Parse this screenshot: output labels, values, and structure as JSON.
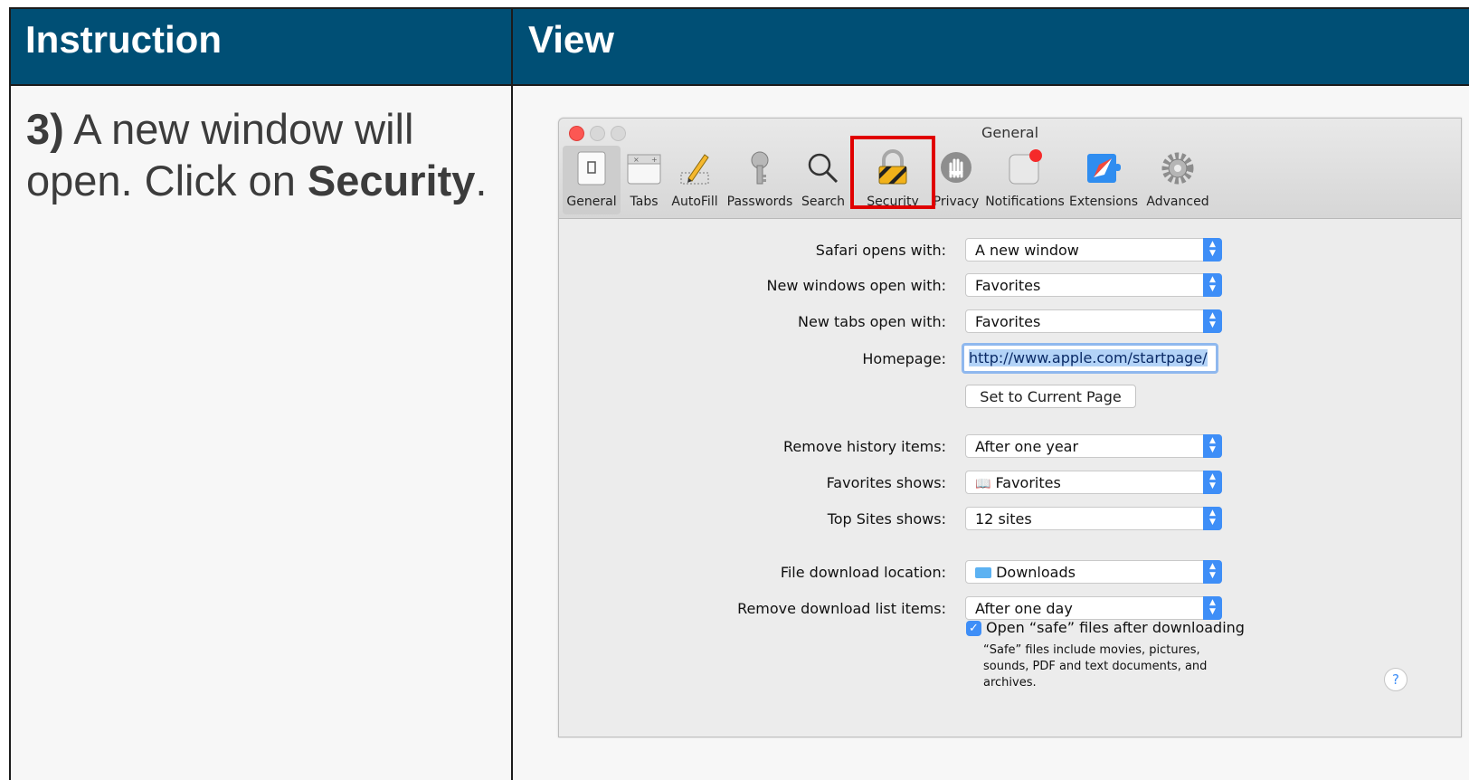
{
  "table": {
    "header_instruction": "Instruction",
    "header_view": "View",
    "step_number": "3)",
    "step_text_1": "A new window will open. Click on",
    "step_target": "Security",
    "step_end": "."
  },
  "window": {
    "title": "General",
    "toolbar": [
      {
        "label": "General",
        "icon": "general-icon"
      },
      {
        "label": "Tabs",
        "icon": "tabs-icon"
      },
      {
        "label": "AutoFill",
        "icon": "autofill-icon"
      },
      {
        "label": "Passwords",
        "icon": "passwords-icon"
      },
      {
        "label": "Search",
        "icon": "search-icon"
      },
      {
        "label": "Security",
        "icon": "lock-icon"
      },
      {
        "label": "Privacy",
        "icon": "privacy-hand-icon"
      },
      {
        "label": "Notifications",
        "icon": "notifications-icon"
      },
      {
        "label": "Extensions",
        "icon": "extensions-icon"
      },
      {
        "label": "Advanced",
        "icon": "gear-icon"
      }
    ],
    "settings": {
      "safari_opens_label": "Safari opens with:",
      "safari_opens_value": "A new window",
      "new_windows_label": "New windows open with:",
      "new_windows_value": "Favorites",
      "new_tabs_label": "New tabs open with:",
      "new_tabs_value": "Favorites",
      "homepage_label": "Homepage:",
      "homepage_value": "http://www.apple.com/startpage/",
      "set_current_label": "Set to Current Page",
      "remove_history_label": "Remove history items:",
      "remove_history_value": "After one year",
      "favorites_shows_label": "Favorites shows:",
      "favorites_shows_value": "Favorites",
      "top_sites_label": "Top Sites shows:",
      "top_sites_value": "12 sites",
      "download_location_label": "File download location:",
      "download_location_value": "Downloads",
      "remove_download_label": "Remove download list items:",
      "remove_download_value": "After one day",
      "open_safe_label": "Open “safe” files after downloading",
      "open_safe_checked": true,
      "safe_note": "“Safe” files include movies, pictures, sounds, PDF and text documents, and archives.",
      "help_label": "?"
    },
    "colors": {
      "accent": "#3e8ef7",
      "highlight_box": "#e00000",
      "header_bg": "#004f75"
    }
  }
}
